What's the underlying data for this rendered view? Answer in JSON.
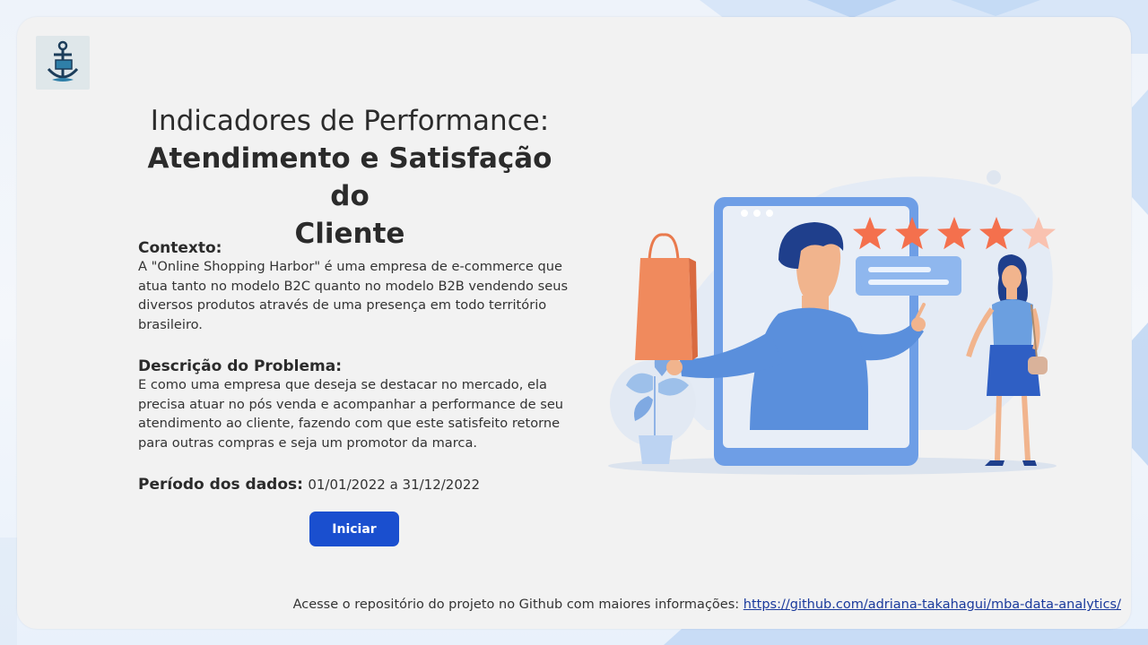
{
  "title": {
    "line1": "Indicadores de Performance:",
    "line2": "Atendimento e Satisfação do",
    "line3": "Cliente"
  },
  "context": {
    "heading": "Contexto:",
    "body": "A \"Online Shopping Harbor\" é uma empresa de e-commerce que atua tanto no modelo B2C quanto no modelo B2B vendendo seus diversos produtos através de uma presença em todo território brasileiro."
  },
  "problem": {
    "heading": "Descrição do Problema:",
    "body": "E como uma empresa que deseja se destacar no mercado, ela precisa atuar no pós venda e acompanhar a performance de seu atendimento ao cliente, fazendo com que este satisfeito retorne para outras compras e seja um promotor da marca."
  },
  "period": {
    "label": "Período dos dados:",
    "value": "01/01/2022 a 31/12/2022"
  },
  "start_button": {
    "label": "Iniciar"
  },
  "footer": {
    "text": "Acesse o repositório do projeto no Github com maiores informações: ",
    "link": "https://github.com/adriana-takahagui/mba-data-analytics/"
  },
  "rating": {
    "filled_stars": 4,
    "total_stars": 5
  },
  "colors": {
    "accent": "#1a4fcf",
    "star": "#f4704d",
    "illustration_blue": "#5a8fdc",
    "bag": "#f08a5d"
  },
  "icons": {
    "logo": "anchor-cart-icon"
  }
}
